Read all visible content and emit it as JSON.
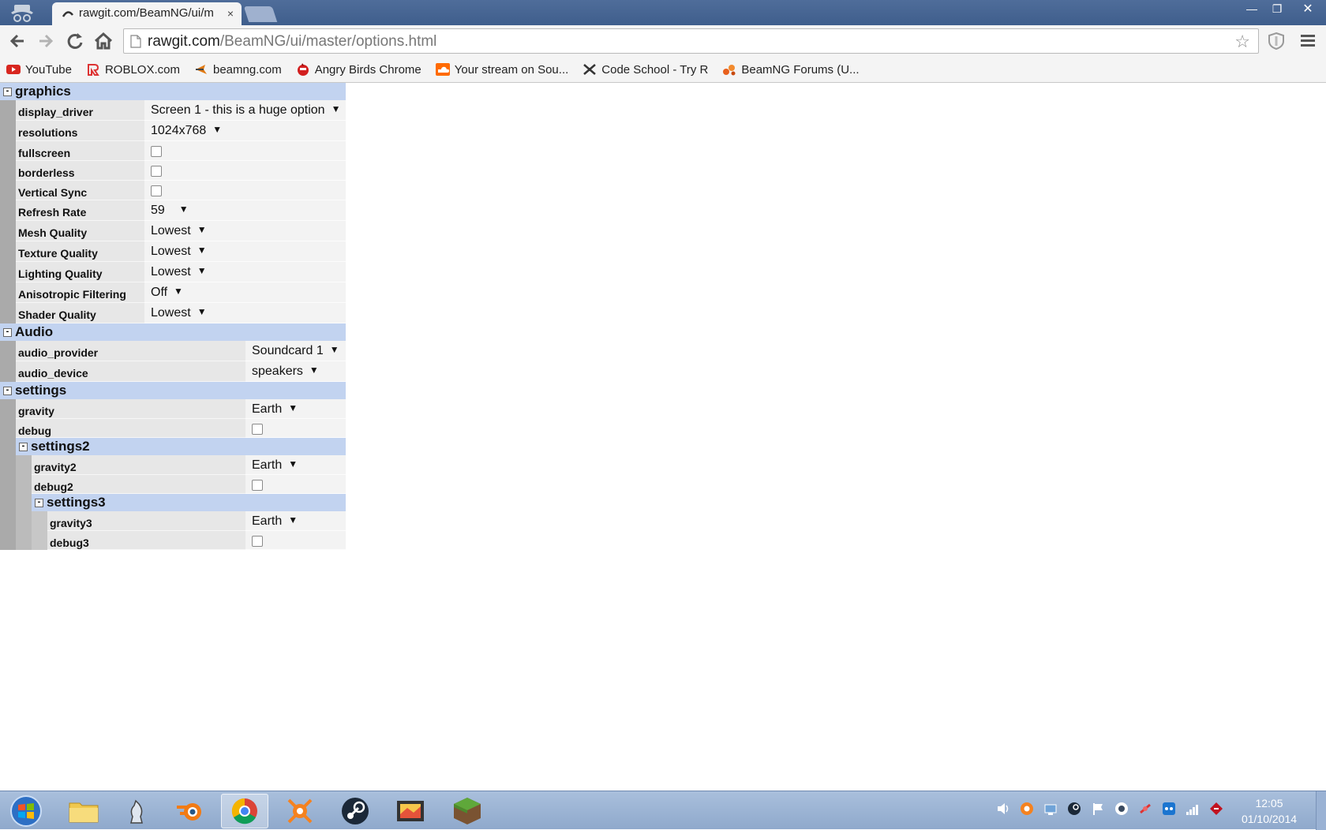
{
  "browser": {
    "tab_title": "rawgit.com/BeamNG/ui/m",
    "tab_close": "×",
    "url_host": "rawgit.com",
    "url_path": "/BeamNG/ui/master/options.html",
    "window_buttons": {
      "minimize": "—",
      "restore": "❐",
      "close": "✕"
    },
    "star": "☆"
  },
  "bookmarks": [
    {
      "label": "YouTube",
      "icon": "youtube-icon"
    },
    {
      "label": "ROBLOX.com",
      "icon": "roblox-icon"
    },
    {
      "label": "beamng.com",
      "icon": "beamng-icon"
    },
    {
      "label": "Angry Birds Chrome",
      "icon": "angry-birds-icon"
    },
    {
      "label": "Your stream on Sou...",
      "icon": "soundcloud-icon"
    },
    {
      "label": "Code School - Try R",
      "icon": "code-school-icon"
    },
    {
      "label": "BeamNG Forums (U...",
      "icon": "beamng-forums-icon"
    }
  ],
  "options": {
    "graphics": {
      "title": "graphics",
      "toggle": "-",
      "rows": [
        {
          "label": "display_driver",
          "value": "Screen 1 - this is a huge option",
          "arrow": "▼"
        },
        {
          "label": "resolutions",
          "value": "1024x768",
          "arrow": "▼"
        },
        {
          "label": "fullscreen"
        },
        {
          "label": "borderless"
        },
        {
          "label": "Vertical Sync"
        },
        {
          "label": "Refresh Rate",
          "value": "59",
          "arrow": "▼"
        },
        {
          "label": "Mesh Quality",
          "value": "Lowest",
          "arrow": "▼"
        },
        {
          "label": "Texture Quality",
          "value": "Lowest",
          "arrow": "▼"
        },
        {
          "label": "Lighting Quality",
          "value": "Lowest",
          "arrow": "▼"
        },
        {
          "label": "Anisotropic Filtering",
          "value": "Off",
          "arrow": "▼"
        },
        {
          "label": "Shader Quality",
          "value": "Lowest",
          "arrow": "▼"
        }
      ]
    },
    "audio": {
      "title": "Audio",
      "toggle": "-",
      "rows": [
        {
          "label": "audio_provider",
          "value": "Soundcard 1",
          "arrow": "▼"
        },
        {
          "label": "audio_device",
          "value": "speakers",
          "arrow": "▼"
        }
      ]
    },
    "settings": {
      "title": "settings",
      "toggle": "-",
      "rows": [
        {
          "label": "gravity",
          "value": "Earth",
          "arrow": "▼"
        },
        {
          "label": "debug"
        }
      ],
      "settings2": {
        "title": "settings2",
        "toggle": "-",
        "rows": [
          {
            "label": "gravity2",
            "value": "Earth",
            "arrow": "▼"
          },
          {
            "label": "debug2"
          }
        ],
        "settings3": {
          "title": "settings3",
          "toggle": "-",
          "rows": [
            {
              "label": "gravity3",
              "value": "Earth",
              "arrow": "▼"
            },
            {
              "label": "debug3"
            }
          ]
        }
      }
    }
  },
  "taskbar": {
    "clock_time": "12:05",
    "clock_date": "01/10/2014"
  }
}
